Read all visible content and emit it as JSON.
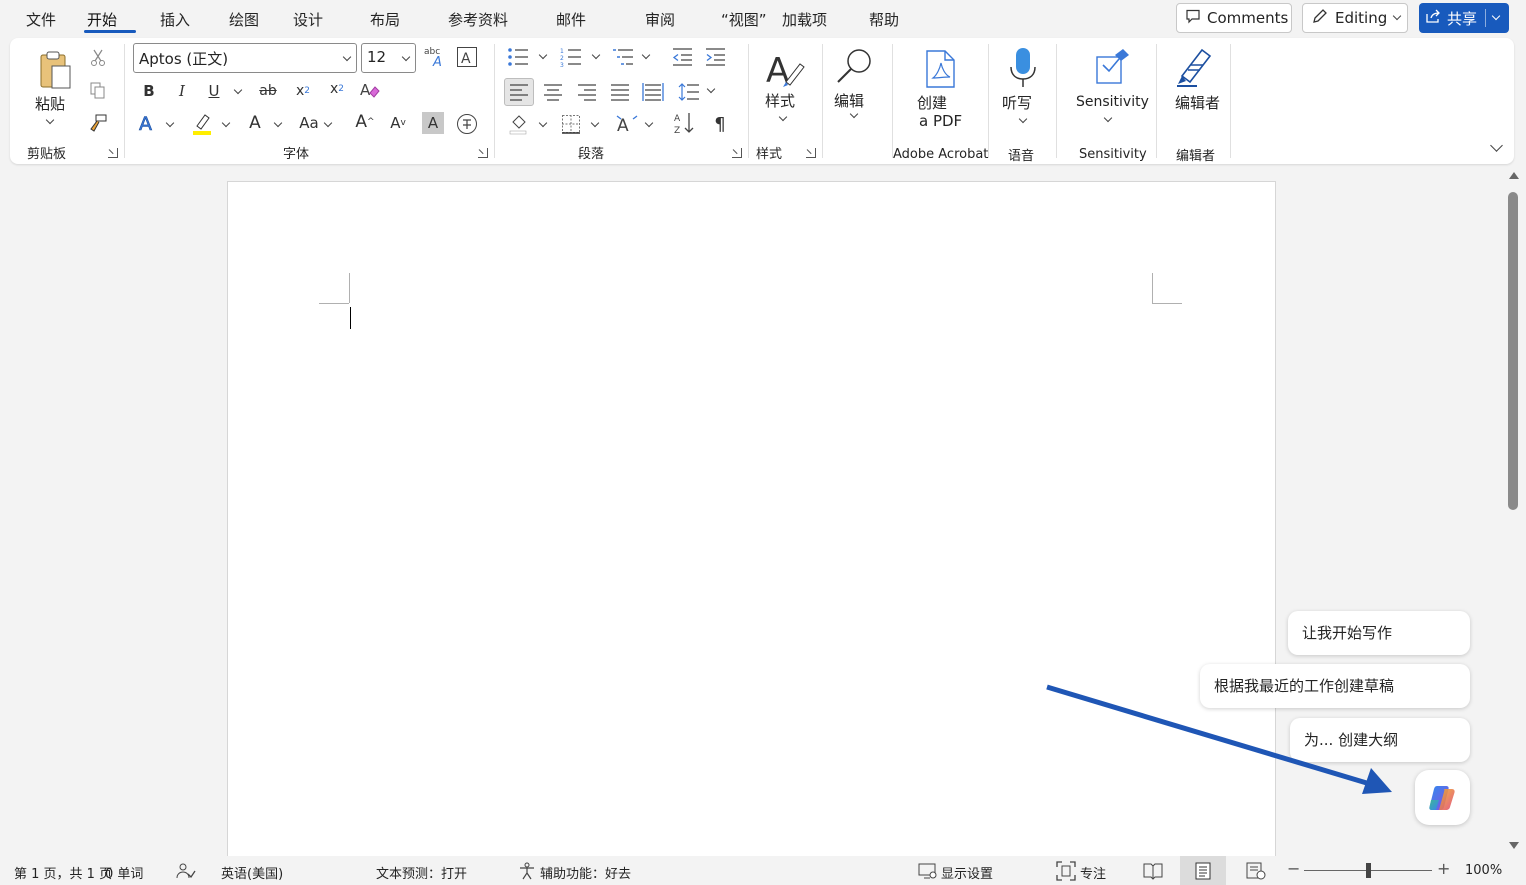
{
  "tabs": [
    "文件",
    "开始",
    "插入",
    "绘图",
    "设计",
    "布局",
    "参考资料",
    "邮件",
    "审阅",
    "“视图”",
    "加载项",
    "帮助"
  ],
  "header": {
    "comments_label": "Comments",
    "editing_label": "Editing",
    "share_label": "共享",
    "accent": "#185abd"
  },
  "ribbon": {
    "clipboard": {
      "paste_label": "粘贴",
      "group_label": "剪贴板"
    },
    "font": {
      "font_name": "Aptos (正文)",
      "font_size": "12",
      "group_label": "字体"
    },
    "paragraph": {
      "group_label": "段落"
    },
    "styles": {
      "label": "样式",
      "group_label": "样式"
    },
    "editing": {
      "label": "编辑"
    },
    "acrobat": {
      "label_line1": "创建",
      "label_line2": "a PDF",
      "group_label": "Adobe Acrobat"
    },
    "voice": {
      "label": "听写",
      "group_label": "语音"
    },
    "sensitivity": {
      "label": "Sensitivity",
      "group_label": "Sensitivity"
    },
    "editor": {
      "label": "编辑者",
      "group_label": "编辑者"
    }
  },
  "copilot": {
    "suggestions": [
      "让我开始写作",
      "根据我最近的工作创建草稿",
      "为... 创建大纲"
    ],
    "arrow_color": "#1f56b5"
  },
  "status": {
    "page_info": "第 1 页，共 1 页",
    "word_count": "0 单词",
    "language": "英语(美国)",
    "text_prediction": "文本预测：打开",
    "accessibility": "辅助功能：好去",
    "display_settings": "显示设置",
    "focus": "专注",
    "zoom": "100%"
  }
}
